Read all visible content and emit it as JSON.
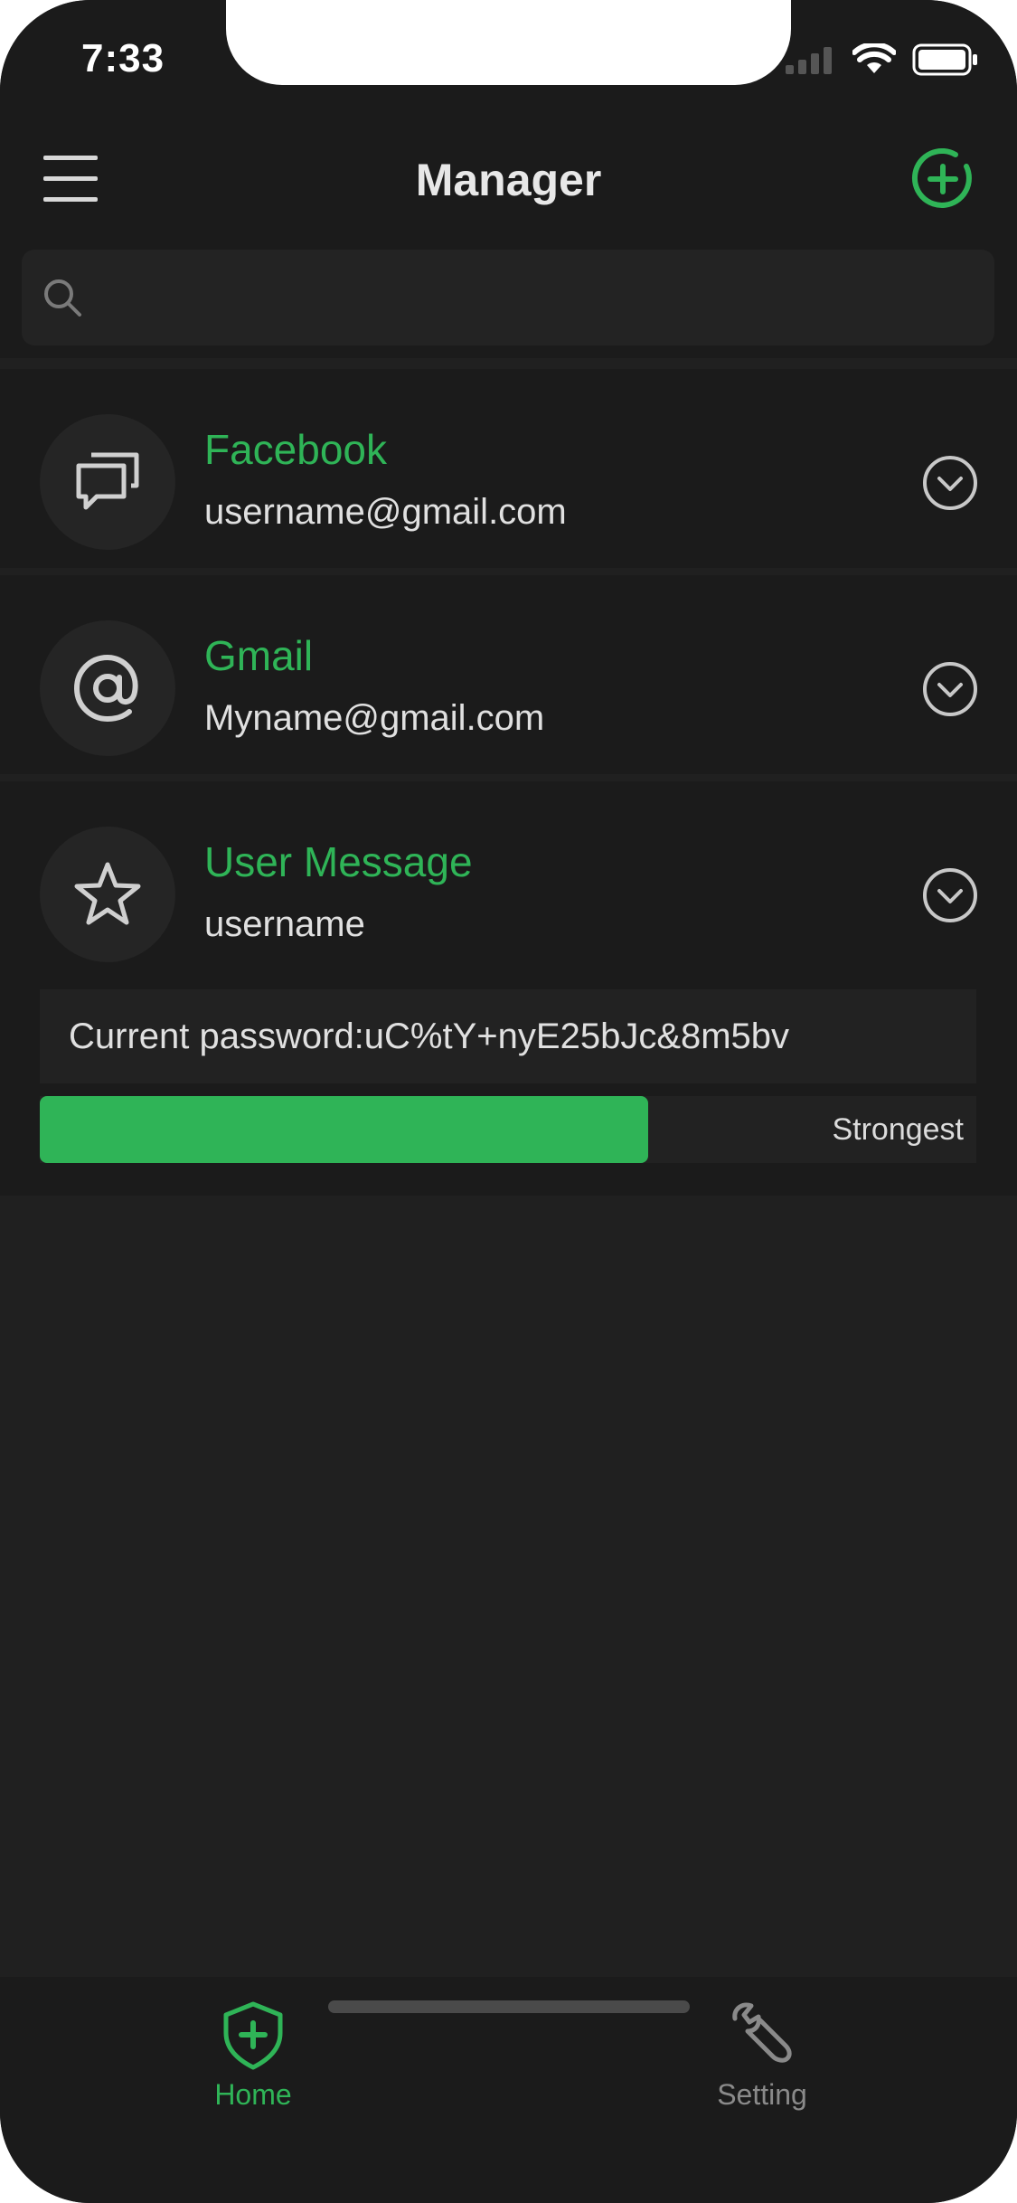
{
  "status_bar": {
    "time": "7:33"
  },
  "nav": {
    "title": "Manager",
    "menu_icon": "hamburger-menu-icon",
    "add_icon": "plus-circle-icon"
  },
  "search": {
    "placeholder": "",
    "value": ""
  },
  "accounts": [
    {
      "title": "Facebook",
      "subtitle": "username@gmail.com",
      "icon": "chat-bubbles-icon"
    },
    {
      "title": "Gmail",
      "subtitle": "Myname@gmail.com",
      "icon": "at-sign-icon"
    },
    {
      "title": "User Message",
      "subtitle": "username",
      "icon": "star-icon",
      "password_text": "Current password:uC%tY+nyE25bJc&8m5bv",
      "strength_label": "Strongest",
      "strength_fraction": 0.65
    }
  ],
  "tabs": [
    {
      "label": "Home",
      "icon": "shield-plus-icon",
      "active": true
    },
    {
      "label": "Setting",
      "icon": "wrench-icon",
      "active": false
    }
  ],
  "colors": {
    "accent": "#2fb457",
    "background": "#202020",
    "panel": "#1b1b1b",
    "text": "#e0e0e0",
    "muted": "#8a8a8a"
  }
}
